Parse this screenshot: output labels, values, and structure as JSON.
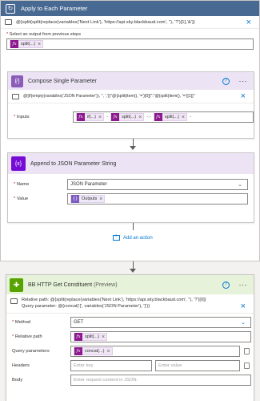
{
  "loop": {
    "title": "Apply to Each Parameter",
    "expression": "@{split(split(replace(variables('Next Link'), 'https://api.sky.blackbaud.com', ''), '?')[1],'&')}",
    "select_label": "Select an output from previous steps",
    "select_token": "split(...)"
  },
  "compose": {
    "title": "Compose Single Parameter",
    "expression": "@{if(empty(variables('JSON Parameter')), '', ',')}\"@{split(item(), '=')[0]}\":\"@{split(item(), '=')[1]}\"",
    "inputs_label": "Inputs",
    "tokens": [
      "if(...)",
      "split(...)",
      "split(...)"
    ],
    "seps": [
      "-",
      "-:-",
      "-"
    ]
  },
  "append": {
    "title": "Append to JSON Parameter String",
    "name_label": "Name",
    "name_value": "JSON Parameter",
    "value_label": "Value",
    "value_token": "Outputs"
  },
  "add_action_label": "Add an action",
  "bbhttp": {
    "title": "BB HTTP Get Constituent",
    "preview": "(Preview)",
    "relative_path_line": "Relative path: @{split(replace(variables('Next Link'), 'https://api.sky.blackbaud.com', ''), '?')[0]}",
    "query_param_line": "Query parameter: @{concat('{', variables('JSON Parameter'), '}')}",
    "method_label": "Method",
    "method_value": "GET",
    "relpath_label": "Relative path",
    "relpath_token": "split(...)",
    "query_label": "Query parameters",
    "query_token": "concat(...)",
    "headers_label": "Headers",
    "headers_key_placeholder": "Enter key",
    "headers_value_placeholder": "Enter value",
    "body_label": "Body",
    "body_placeholder": "Enter request content in JSON."
  },
  "colors": {
    "loop_header": "#486991",
    "compose_icon": "#8b5cb8",
    "append_icon": "#770bd6",
    "bbhttp_icon": "#57a300",
    "fx_token": "#8c1a8e",
    "link": "#0078d4"
  },
  "icons": {
    "loop": "loop-icon",
    "compose": "braces-icon",
    "append": "variable-icon",
    "bbhttp": "puzzle-icon"
  }
}
